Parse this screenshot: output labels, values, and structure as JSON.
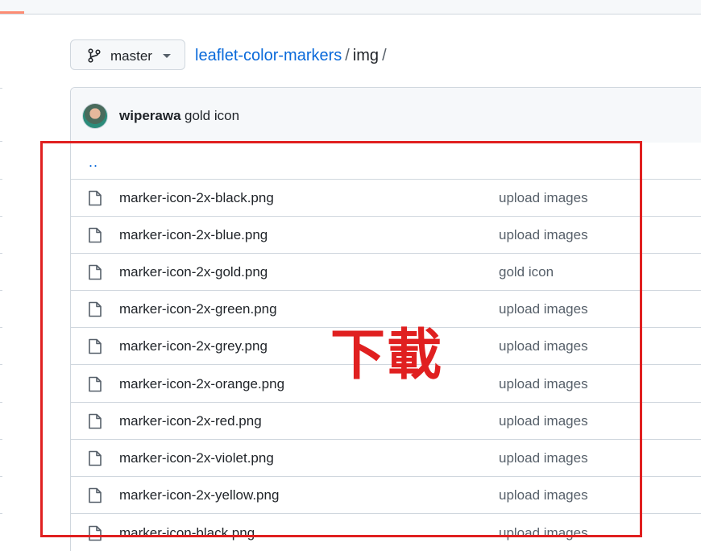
{
  "branch": {
    "label": "master"
  },
  "breadcrumb": {
    "repo": "leaflet-color-markers",
    "sep1": "/",
    "dir": "img",
    "sep2": "/"
  },
  "commit": {
    "author": "wiperawa",
    "message": "gold icon"
  },
  "parent_link": "..",
  "files": [
    {
      "name": "marker-icon-2x-black.png",
      "commit": "upload images"
    },
    {
      "name": "marker-icon-2x-blue.png",
      "commit": "upload images"
    },
    {
      "name": "marker-icon-2x-gold.png",
      "commit": "gold icon"
    },
    {
      "name": "marker-icon-2x-green.png",
      "commit": "upload images"
    },
    {
      "name": "marker-icon-2x-grey.png",
      "commit": "upload images"
    },
    {
      "name": "marker-icon-2x-orange.png",
      "commit": "upload images"
    },
    {
      "name": "marker-icon-2x-red.png",
      "commit": "upload images"
    },
    {
      "name": "marker-icon-2x-violet.png",
      "commit": "upload images"
    },
    {
      "name": "marker-icon-2x-yellow.png",
      "commit": "upload images"
    },
    {
      "name": "marker-icon-black.png",
      "commit": "upload images"
    }
  ],
  "annotation": {
    "text": "下載",
    "color": "#e02020"
  },
  "colors": {
    "link": "#0969da",
    "border": "#d0d7de",
    "muted": "#57606a"
  },
  "icons": {
    "branch": "git-branch-icon",
    "caret": "chevron-down-icon",
    "file": "file-icon"
  }
}
